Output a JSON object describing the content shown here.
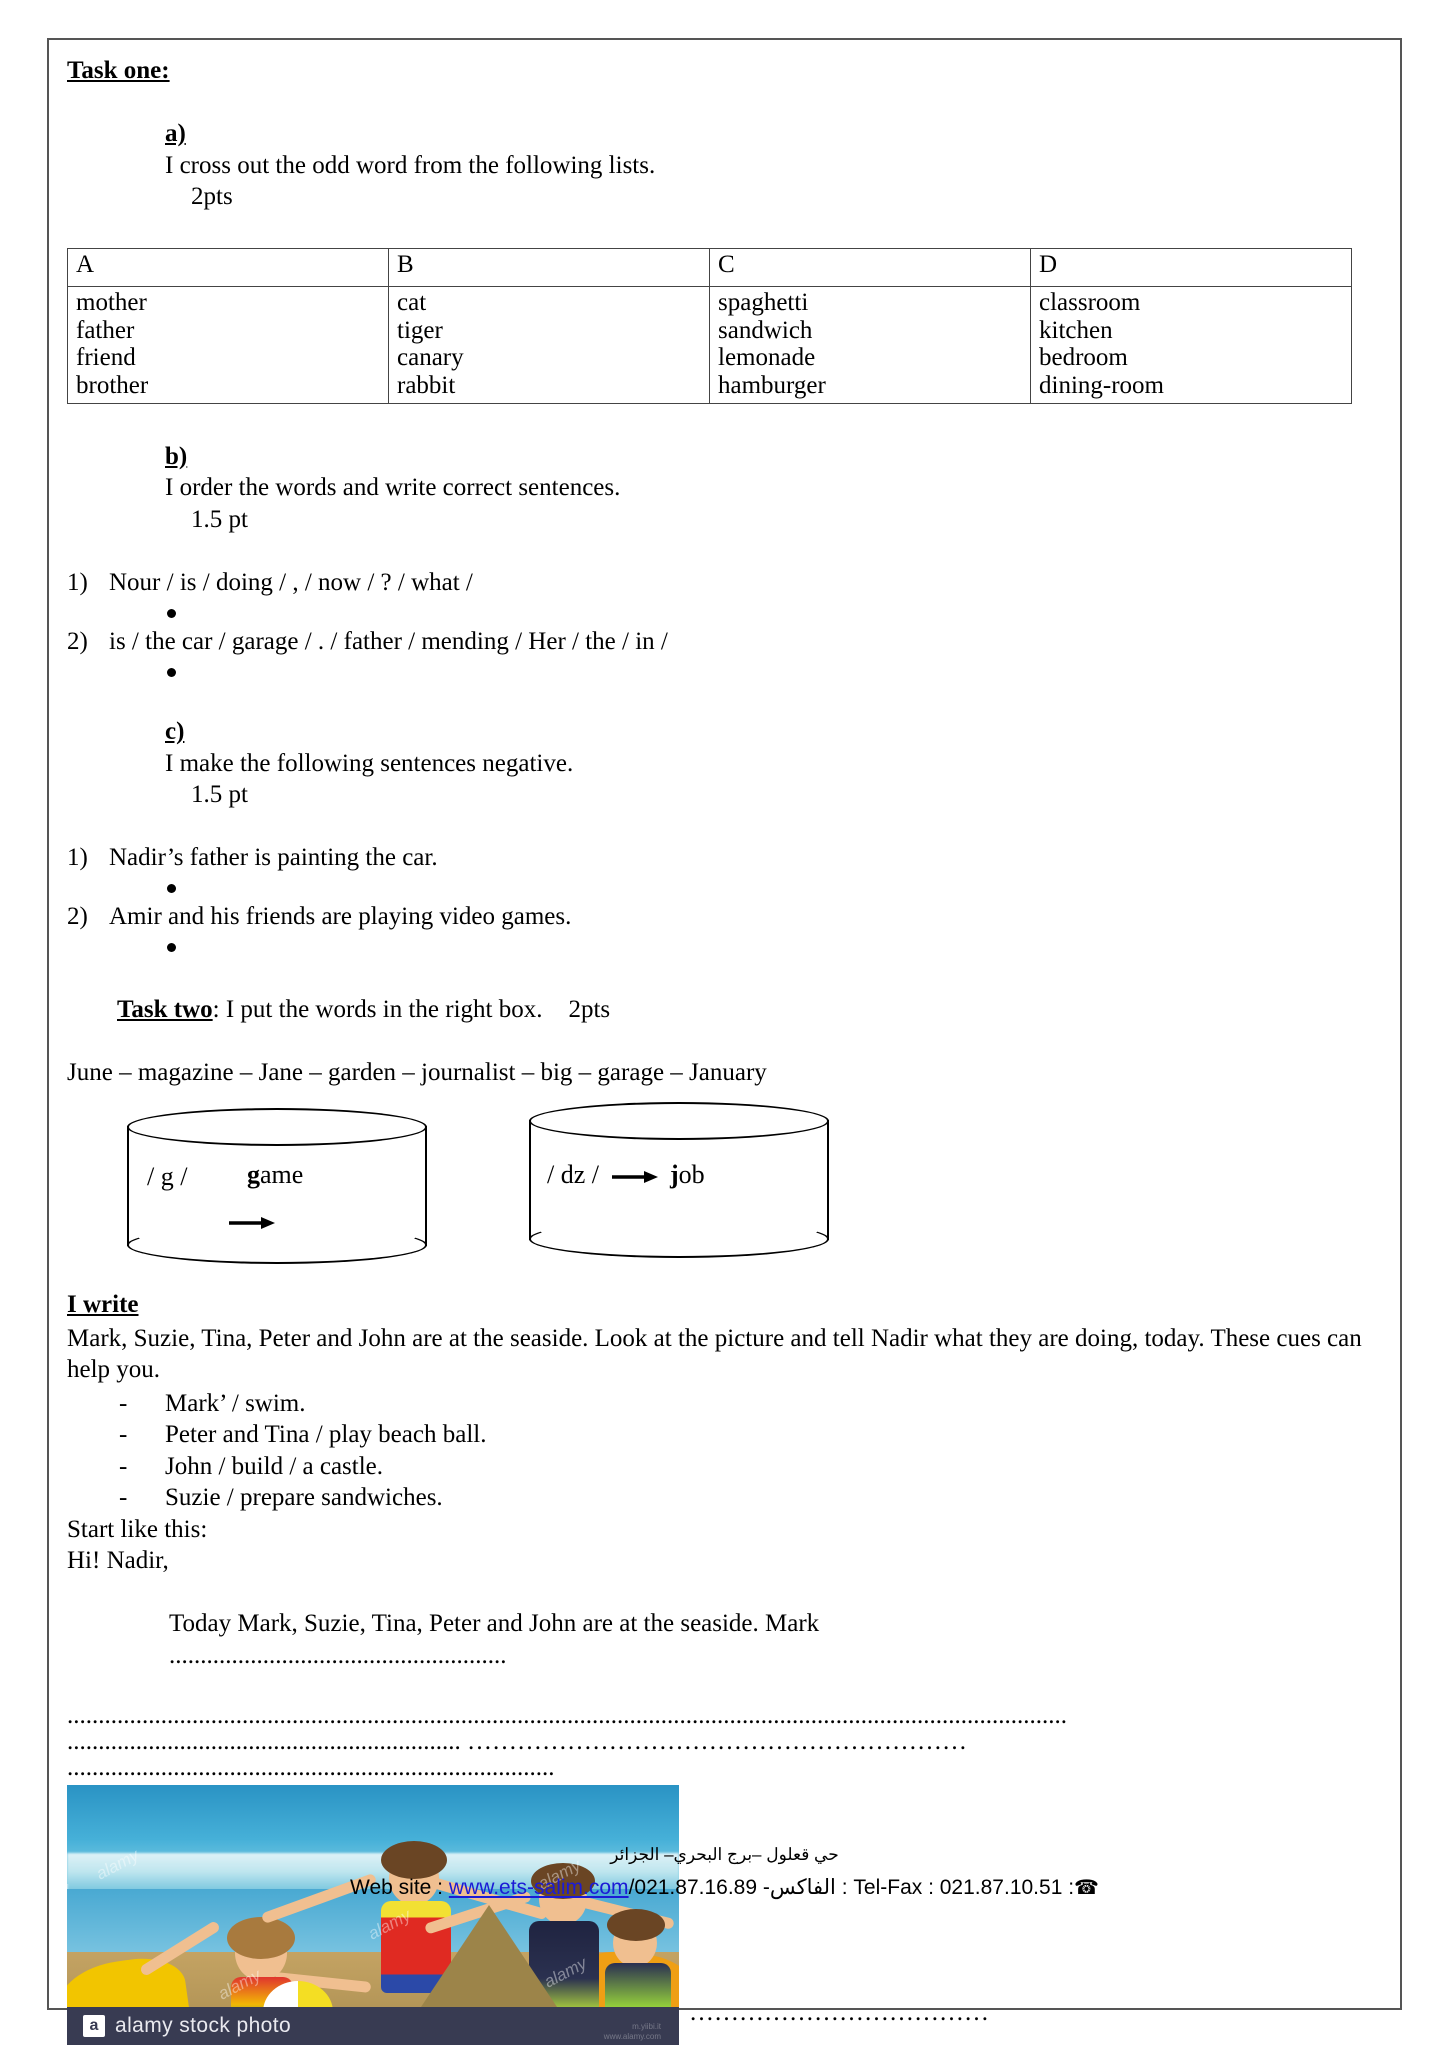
{
  "task_one": {
    "title": "Task one:",
    "part_a": {
      "label": "a)",
      "instruction": "I cross out the odd word from the following lists.",
      "points": "2pts"
    },
    "table": {
      "headers": [
        "A",
        "B",
        "C",
        "D"
      ],
      "columns": [
        [
          "mother",
          "father",
          "friend",
          "brother"
        ],
        [
          "cat",
          "tiger",
          "canary",
          "rabbit"
        ],
        [
          "spaghetti",
          "sandwich",
          "lemonade",
          "hamburger"
        ],
        [
          "classroom",
          "kitchen",
          "bedroom",
          "dining-room"
        ]
      ]
    },
    "part_b": {
      "label": "b)",
      "instruction": "I order the words and write correct sentences.",
      "points": "1.5 pt",
      "items": [
        {
          "num": "1)",
          "text": "Nour / is / doing / , / now / ? / what /"
        },
        {
          "num": "2)",
          "text": "is / the car / garage / . / father / mending / Her / the / in /"
        }
      ]
    },
    "part_c": {
      "label": "c)",
      "instruction": "I make the following sentences negative.",
      "points": "1.5 pt",
      "items": [
        {
          "num": "1)",
          "text": "Nadir’s father is painting the car."
        },
        {
          "num": "2)",
          "text": "Amir and his friends are playing video games."
        }
      ]
    }
  },
  "task_two": {
    "title": "Task two",
    "instruction": ": I put the words in the right box.",
    "points": "2pts",
    "word_bank": "June – magazine – Jane – garden – journalist – big – garage – January",
    "boxes": [
      {
        "phoneme": "/ g /",
        "example_bold": "g",
        "example_rest": "ame",
        "has_lower_arrow": true,
        "has_inline_arrow": false
      },
      {
        "phoneme": "/ dz /",
        "example_bold": "j",
        "example_rest": "ob",
        "has_lower_arrow": false,
        "has_inline_arrow": true
      }
    ]
  },
  "i_write": {
    "title": "I write",
    "paragraph": "Mark, Suzie, Tina, Peter and John are at the seaside. Look at the picture and tell Nadir what they are doing, today. These cues can help you.",
    "cues": [
      "Mark’ / swim.",
      "Peter and Tina / play beach ball.",
      "John / build / a castle.",
      "Suzie / prepare sandwiches."
    ],
    "cue_dash": "-",
    "start_label": "Start like this:",
    "greeting": "Hi! Nadir,",
    "starter": "Today Mark, Suzie, Tina, Peter and John are at the seaside. Mark",
    "dots_starter": "......................................................",
    "dots_full": "................................................................................................................................................................",
    "dots_line3_a": "...............................................................",
    "dots_line3_b": "……………………………………………………",
    "dots_line4": "..............................................................................",
    "dots_after_photo": "………………………………"
  },
  "photo": {
    "alamy_badge": "a",
    "alamy_label": "alamy stock photo",
    "watermark_text": "alamy",
    "corner_note_line1": "m.yiibi.it",
    "corner_note_line2": "www.alamy.com"
  },
  "footer": {
    "address_ar": "حي قعلول –برج البحري– الجزائر",
    "website_label": "Web site :",
    "website_url": "www.ets-salim.com",
    "fax_number": "/021.87.16.89",
    "fax_label_ar": "-الفاكس :",
    "telfax_label": "Tel-Fax : 021.87.10.51 :",
    "phone_icon": "☎",
    "link_color": "#1b1bd6"
  }
}
